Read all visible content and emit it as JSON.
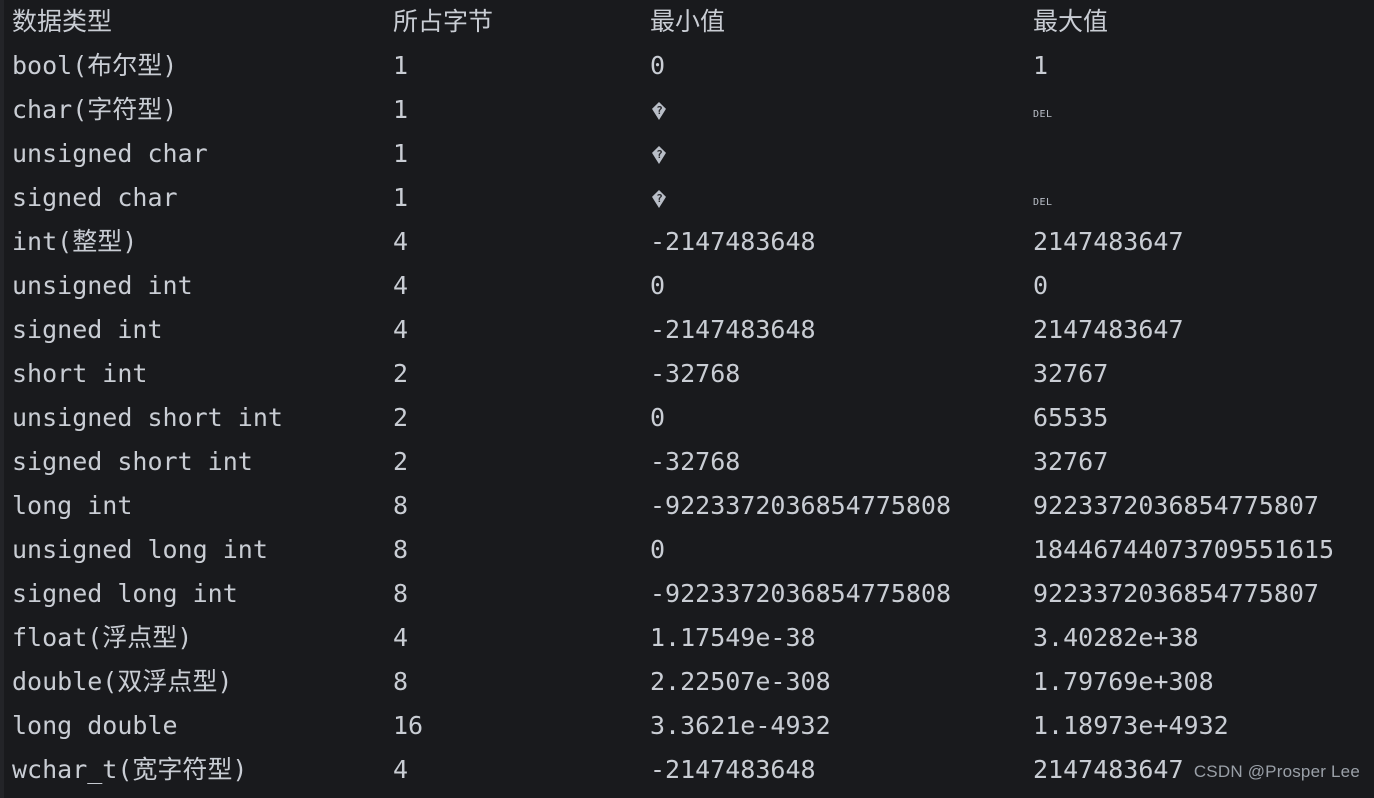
{
  "watermark": "CSDN @Prosper Lee",
  "table": {
    "columns": [
      "数据类型",
      "所占字节",
      "最小值",
      "最大值"
    ],
    "rows": [
      {
        "type": "bool(布尔型)",
        "bytes": "1",
        "min": "0",
        "max": "1"
      },
      {
        "type": "char(字符型)",
        "bytes": "1",
        "min": "�",
        "max": "␡"
      },
      {
        "type": "unsigned char",
        "bytes": "1",
        "min": "�",
        "max": ""
      },
      {
        "type": "signed char",
        "bytes": "1",
        "min": "�",
        "max": "␡"
      },
      {
        "type": "int(整型)",
        "bytes": "4",
        "min": "-2147483648",
        "max": "2147483647"
      },
      {
        "type": "unsigned int",
        "bytes": "4",
        "min": "0",
        "max": "0"
      },
      {
        "type": "signed int",
        "bytes": "4",
        "min": "-2147483648",
        "max": "2147483647"
      },
      {
        "type": "short int",
        "bytes": "2",
        "min": "-32768",
        "max": "32767"
      },
      {
        "type": "unsigned short int",
        "bytes": "2",
        "min": "0",
        "max": "65535"
      },
      {
        "type": "signed short int",
        "bytes": "2",
        "min": "-32768",
        "max": "32767"
      },
      {
        "type": "long int",
        "bytes": "8",
        "min": "-9223372036854775808",
        "max": "9223372036854775807"
      },
      {
        "type": "unsigned long int",
        "bytes": "8",
        "min": "0",
        "max": "18446744073709551615"
      },
      {
        "type": "signed long int",
        "bytes": "8",
        "min": "-9223372036854775808",
        "max": "9223372036854775807"
      },
      {
        "type": "float(浮点型)",
        "bytes": "4",
        "min": "1.17549e-38",
        "max": "3.40282e+38"
      },
      {
        "type": "double(双浮点型)",
        "bytes": "8",
        "min": "2.22507e-308",
        "max": "1.79769e+308"
      },
      {
        "type": "long double",
        "bytes": "16",
        "min": "3.3621e-4932",
        "max": "1.18973e+4932"
      },
      {
        "type": "wchar_t(宽字符型)",
        "bytes": "4",
        "min": "-2147483648",
        "max": "2147483647"
      }
    ]
  },
  "colors": {
    "background": "#191a1d",
    "text": "#c9cdd4",
    "watermark": "#9aa0a8"
  }
}
